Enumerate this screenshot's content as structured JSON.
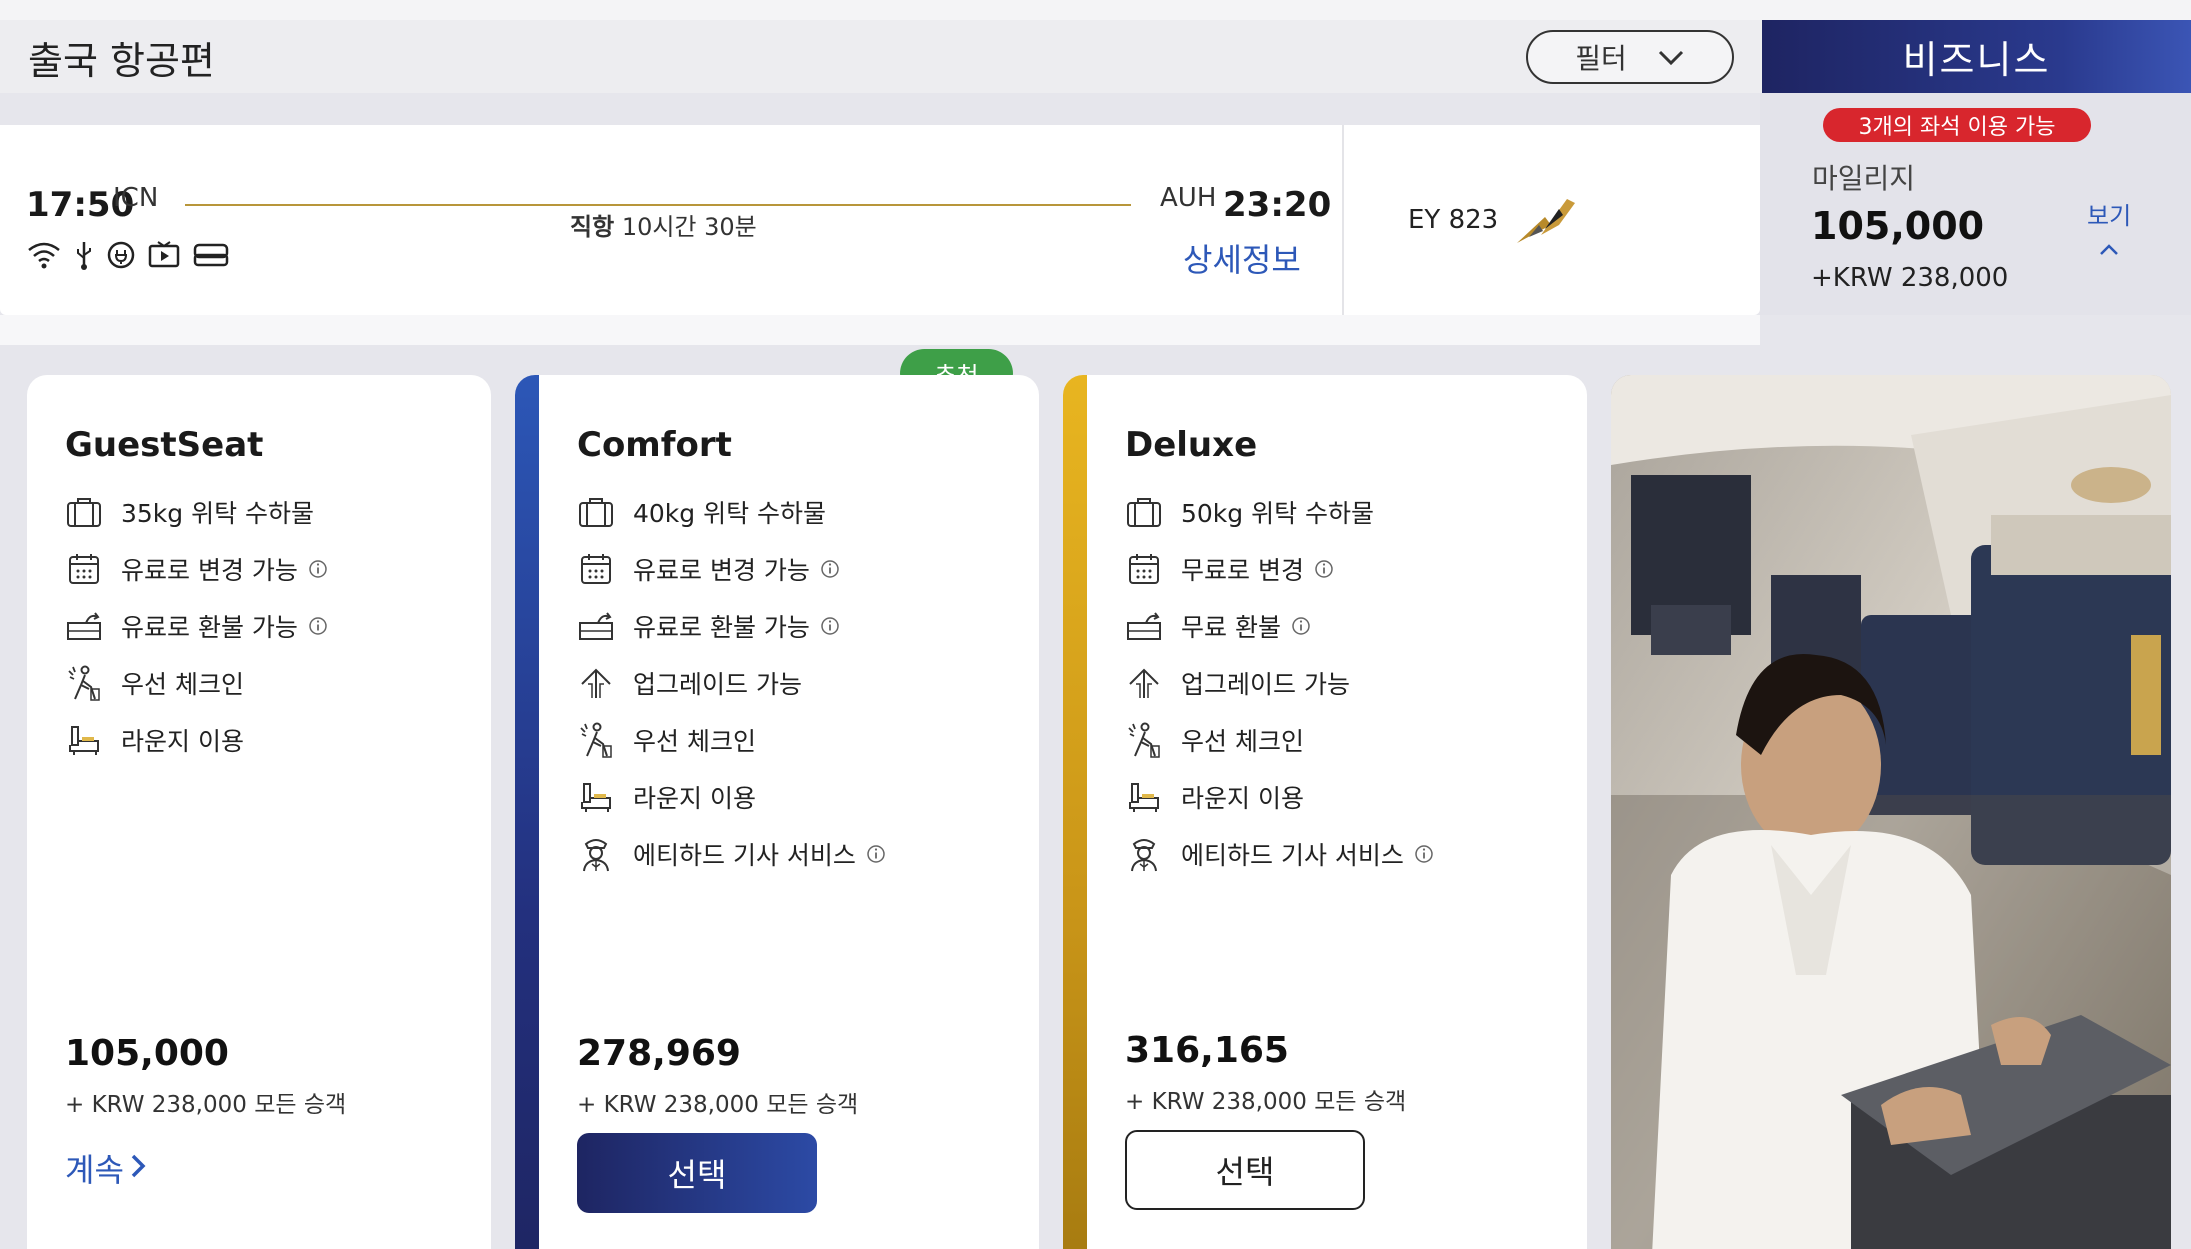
{
  "header": {
    "title": "출국 항공편",
    "filter_label": "필터",
    "cabin_tab": "비즈니스"
  },
  "flight": {
    "dep_time": "17:50",
    "dep_code": "ICN",
    "route_type": "직항",
    "duration": "10시간 30분",
    "arr_code": "AUH",
    "arr_time": "23:20",
    "details_link": "상세정보",
    "flight_number": "EY 823",
    "amenities": [
      "wifi-icon",
      "usb-icon",
      "power-icon",
      "entertainment-icon",
      "flat-bed-icon"
    ]
  },
  "price_panel": {
    "seats_badge": "3개의 좌석 이용 가능",
    "miles_label": "마일리지",
    "miles_value": "105,000",
    "krw": "+KRW 238,000",
    "view_link": "보기"
  },
  "fares": [
    {
      "name": "GuestSeat",
      "features": [
        {
          "icon": "baggage-icon",
          "label": "35kg 위탁 수하물",
          "info": false
        },
        {
          "icon": "calendar-icon",
          "label": "유료로 변경 가능",
          "info": true
        },
        {
          "icon": "refund-icon",
          "label": "유료로 환불 가능",
          "info": true
        },
        {
          "icon": "priority-checkin-icon",
          "label": "우선 체크인",
          "info": false
        },
        {
          "icon": "lounge-icon",
          "label": "라운지 이용",
          "info": false
        }
      ],
      "price": "105,000",
      "sub": "+ KRW 238,000 모든 승객",
      "action": "계속"
    },
    {
      "name": "Comfort",
      "badge": "추천",
      "features": [
        {
          "icon": "baggage-icon",
          "label": "40kg 위탁 수하물",
          "info": false
        },
        {
          "icon": "calendar-icon",
          "label": "유료로 변경 가능",
          "info": true
        },
        {
          "icon": "refund-icon",
          "label": "유료로 환불 가능",
          "info": true
        },
        {
          "icon": "upgrade-icon",
          "label": "업그레이드 가능",
          "info": false
        },
        {
          "icon": "priority-checkin-icon",
          "label": "우선 체크인",
          "info": false
        },
        {
          "icon": "lounge-icon",
          "label": "라운지 이용",
          "info": false
        },
        {
          "icon": "chauffeur-icon",
          "label": "에티하드 기사 서비스",
          "info": true
        }
      ],
      "price": "278,969",
      "sub": "+ KRW 238,000 모든 승객",
      "action": "선택"
    },
    {
      "name": "Deluxe",
      "features": [
        {
          "icon": "baggage-icon",
          "label": "50kg 위탁 수하물",
          "info": false
        },
        {
          "icon": "calendar-icon",
          "label": "무료로 변경",
          "info": true
        },
        {
          "icon": "refund-icon",
          "label": "무료 환불",
          "info": true
        },
        {
          "icon": "upgrade-icon",
          "label": "업그레이드 가능",
          "info": false
        },
        {
          "icon": "priority-checkin-icon",
          "label": "우선 체크인",
          "info": false
        },
        {
          "icon": "lounge-icon",
          "label": "라운지 이용",
          "info": false
        },
        {
          "icon": "chauffeur-icon",
          "label": "에티하드 기사 서비스",
          "info": true
        }
      ],
      "price": "316,165",
      "sub": "+ KRW 238,000 모든 승객",
      "action": "선택"
    }
  ],
  "colors": {
    "brand_navy": "#1e2562",
    "link_blue": "#2d58b8",
    "gold": "#c99518",
    "badge_red": "#d8262d",
    "badge_green": "#3e9f48"
  }
}
